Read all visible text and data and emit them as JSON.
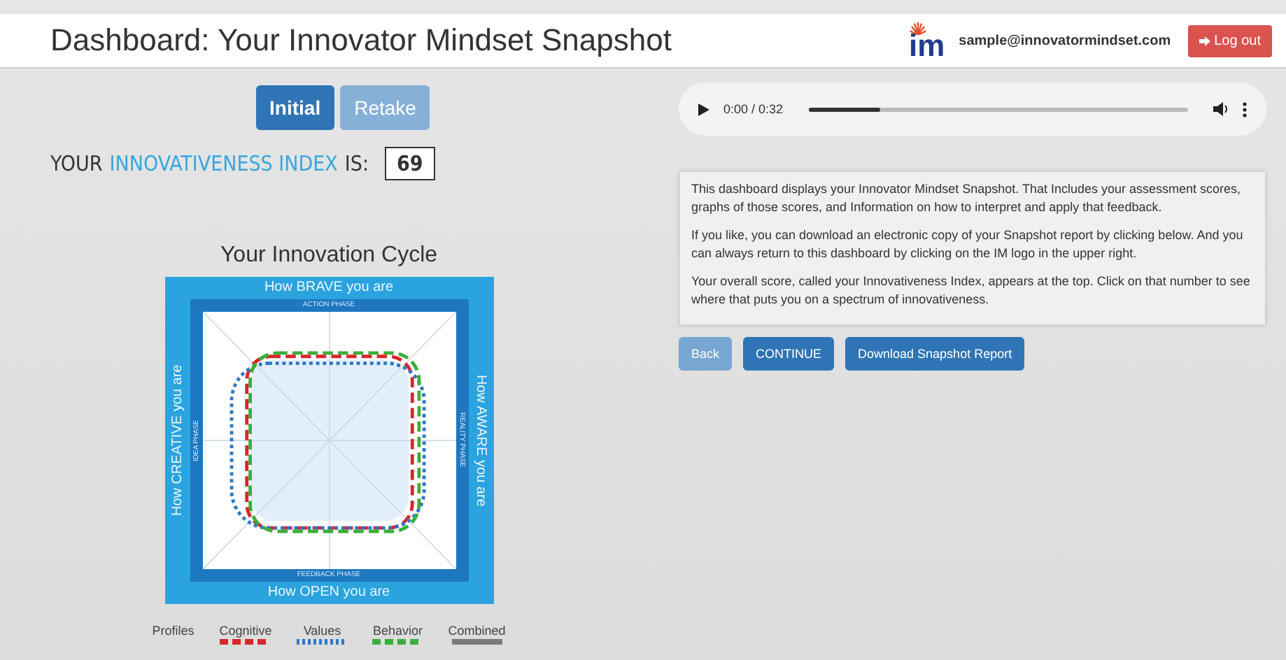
{
  "header": {
    "title": "Dashboard: Your Innovator Mindset Snapshot",
    "logo_text": "im",
    "email": "sample@innovatormindset.com",
    "logout": "Log out"
  },
  "tabs": [
    {
      "label": "Initial",
      "selected": true
    },
    {
      "label": "Retake",
      "selected": false
    }
  ],
  "index": {
    "prefix": "YOUR",
    "highlight": "INNOVATIVENESS INDEX",
    "suffix": "IS:",
    "value": "69"
  },
  "cycle": {
    "title": "Your Innovation Cycle",
    "top": "How BRAVE you are",
    "bottom": "How OPEN you are",
    "left": "How CREATIVE you are",
    "right": "How AWARE you are",
    "phase_top": "ACTION PHASE",
    "phase_bottom": "FEEDBACK PHASE",
    "phase_left": "IDEA PHASE",
    "phase_right": "REALITY PHASE"
  },
  "legend": {
    "label": "Profiles",
    "items": [
      {
        "name": "Cognitive",
        "color": "#d9262b",
        "kind": "dashed"
      },
      {
        "name": "Values",
        "color": "#2c78c8",
        "kind": "dotted"
      },
      {
        "name": "Behavior",
        "color": "#3aae3a",
        "kind": "dashed"
      },
      {
        "name": "Combined",
        "color": "#7a7a7a",
        "kind": "solid"
      }
    ]
  },
  "audio": {
    "time": "0:00 / 0:32",
    "level": 0.19
  },
  "info": [
    "This dashboard displays your Innovator Mindset Snapshot. That Includes your assessment scores, graphs of those scores, and Information on how to interpret and apply that feedback.",
    "If you like, you can download an electronic copy of your Snapshot report by clicking below. And you can always return to this dashboard by clicking on the IM logo in the upper right.",
    "Your overall score, called your Innovativeness Index, appears at the top. Click on that number to see where that puts you on a spectrum of innovativeness."
  ],
  "buttons": [
    {
      "label": "Back",
      "disabled": true
    },
    {
      "label": "CONTINUE",
      "disabled": false
    },
    {
      "label": "Download Snapshot Report",
      "disabled": false
    }
  ]
}
